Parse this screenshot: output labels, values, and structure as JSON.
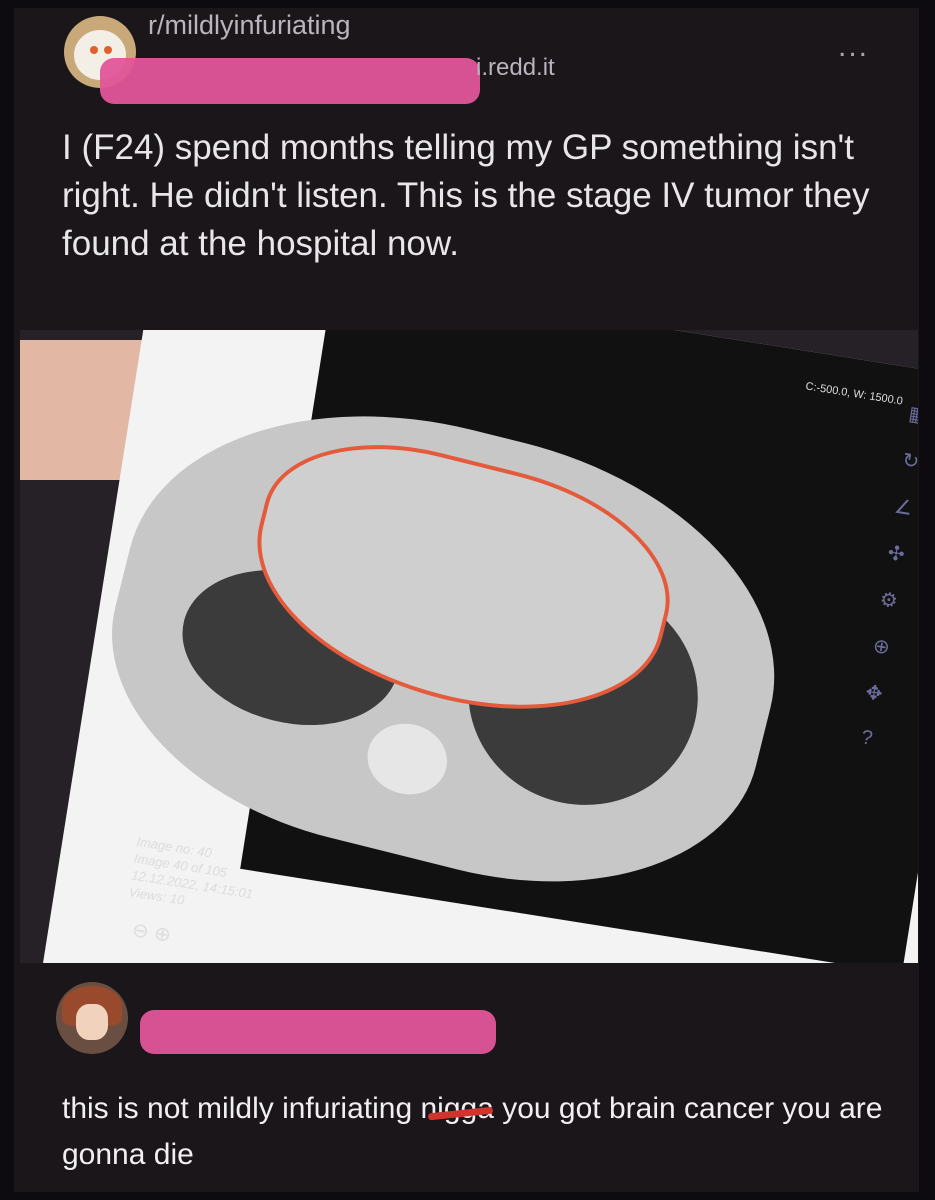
{
  "post": {
    "subreddit": "r/mildlyinfuriating",
    "domain": "i.redd.it",
    "more_label": "...",
    "title": "I (F24) spend months telling my GP something isn't right. He didn't listen. This is the stage IV tumor they found at the hospital now."
  },
  "scan": {
    "window_level": "C:-500.0, W: 1500.0",
    "info": [
      "Image no: 40",
      "Image 40 of 105",
      "12.12.2022, 14:15:01",
      "Views: 10"
    ]
  },
  "comment": {
    "text_before": "this is not mildly infuriating ",
    "censored_word": "nigga",
    "text_after": " you got brain cancer you are gonna die"
  },
  "colors": {
    "background": "#1a1619",
    "redaction": "#e2559a",
    "annotation_circle": "#e45a3b"
  }
}
